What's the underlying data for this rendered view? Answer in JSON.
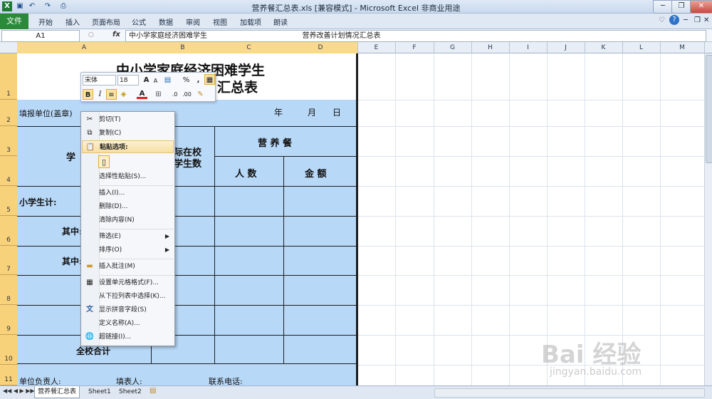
{
  "titlebar": {
    "title": "营养餐汇总表.xls  [兼容模式]  -  Microsoft Excel 非商业用途",
    "minimize": "─",
    "restore": "❐",
    "close": "✕"
  },
  "ribbon": {
    "file_tab": "文件",
    "tabs": [
      "开始",
      "插入",
      "页面布局",
      "公式",
      "数据",
      "审阅",
      "视图",
      "加载项",
      "朗读"
    ]
  },
  "formula_bar": {
    "name_box": "A1",
    "fx": "fx",
    "content": "中小学家庭经济困难学生                                          营养改善计划情况汇总表"
  },
  "columns": [
    "A",
    "B",
    "C",
    "D",
    "E",
    "F",
    "G",
    "H",
    "I",
    "J",
    "K",
    "L",
    "M"
  ],
  "rows": [
    "1",
    "2",
    "3",
    "4",
    "5",
    "6",
    "7",
    "8",
    "9",
    "10",
    "11"
  ],
  "sheet_cells": {
    "title_line1": "中小学家庭经济困难学生",
    "title_line2": "汇总表",
    "unit": "填报单位(盖章)",
    "year": "年",
    "month": "月",
    "day": "日",
    "col_a_header": "学",
    "col_b_header1": "际在校",
    "col_b_header2": "学生数",
    "nutrition": "营  养  餐",
    "count": "人  数",
    "amount": "金   额",
    "primary_total": "小学生计:",
    "among1": "其中:",
    "among2": "其中:",
    "school_total": "全校合计",
    "footer_head": "单位负责人:",
    "footer_filler": "填表人:",
    "footer_phone": "联系电话:"
  },
  "mini_toolbar": {
    "font_name": "宋体",
    "font_size": "18",
    "grow": "A",
    "shrink": "A",
    "percent": "%",
    "comma": ",",
    "bold": "B",
    "italic": "I",
    "font_color": "A"
  },
  "context_menu": {
    "items": [
      {
        "label": "剪切(T)"
      },
      {
        "label": "复制(C)"
      },
      {
        "label": "粘贴选项:"
      },
      {
        "label": "选择性粘贴(S)..."
      },
      {
        "label": "插入(I)..."
      },
      {
        "label": "删除(D)..."
      },
      {
        "label": "清除内容(N)"
      },
      {
        "label": "筛选(E)"
      },
      {
        "label": "排序(O)"
      },
      {
        "label": "插入批注(M)"
      },
      {
        "label": "设置单元格格式(F)..."
      },
      {
        "label": "从下拉列表中选择(K)..."
      },
      {
        "label": "显示拼音字段(S)"
      },
      {
        "label": "定义名称(A)..."
      },
      {
        "label": "超链接(I)..."
      }
    ]
  },
  "sheet_tabs": [
    "营养餐汇总表",
    "Sheet1",
    "Sheet2"
  ],
  "watermark": {
    "brand": "Bai  经验",
    "url": "jingyan.baidu.com"
  },
  "colors": {
    "file_tab": "#2a8a3a",
    "cell_fill": "#b8d8f7",
    "row_header_selected": "#f7d27a",
    "menu_highlight": "#f6dfa3"
  }
}
